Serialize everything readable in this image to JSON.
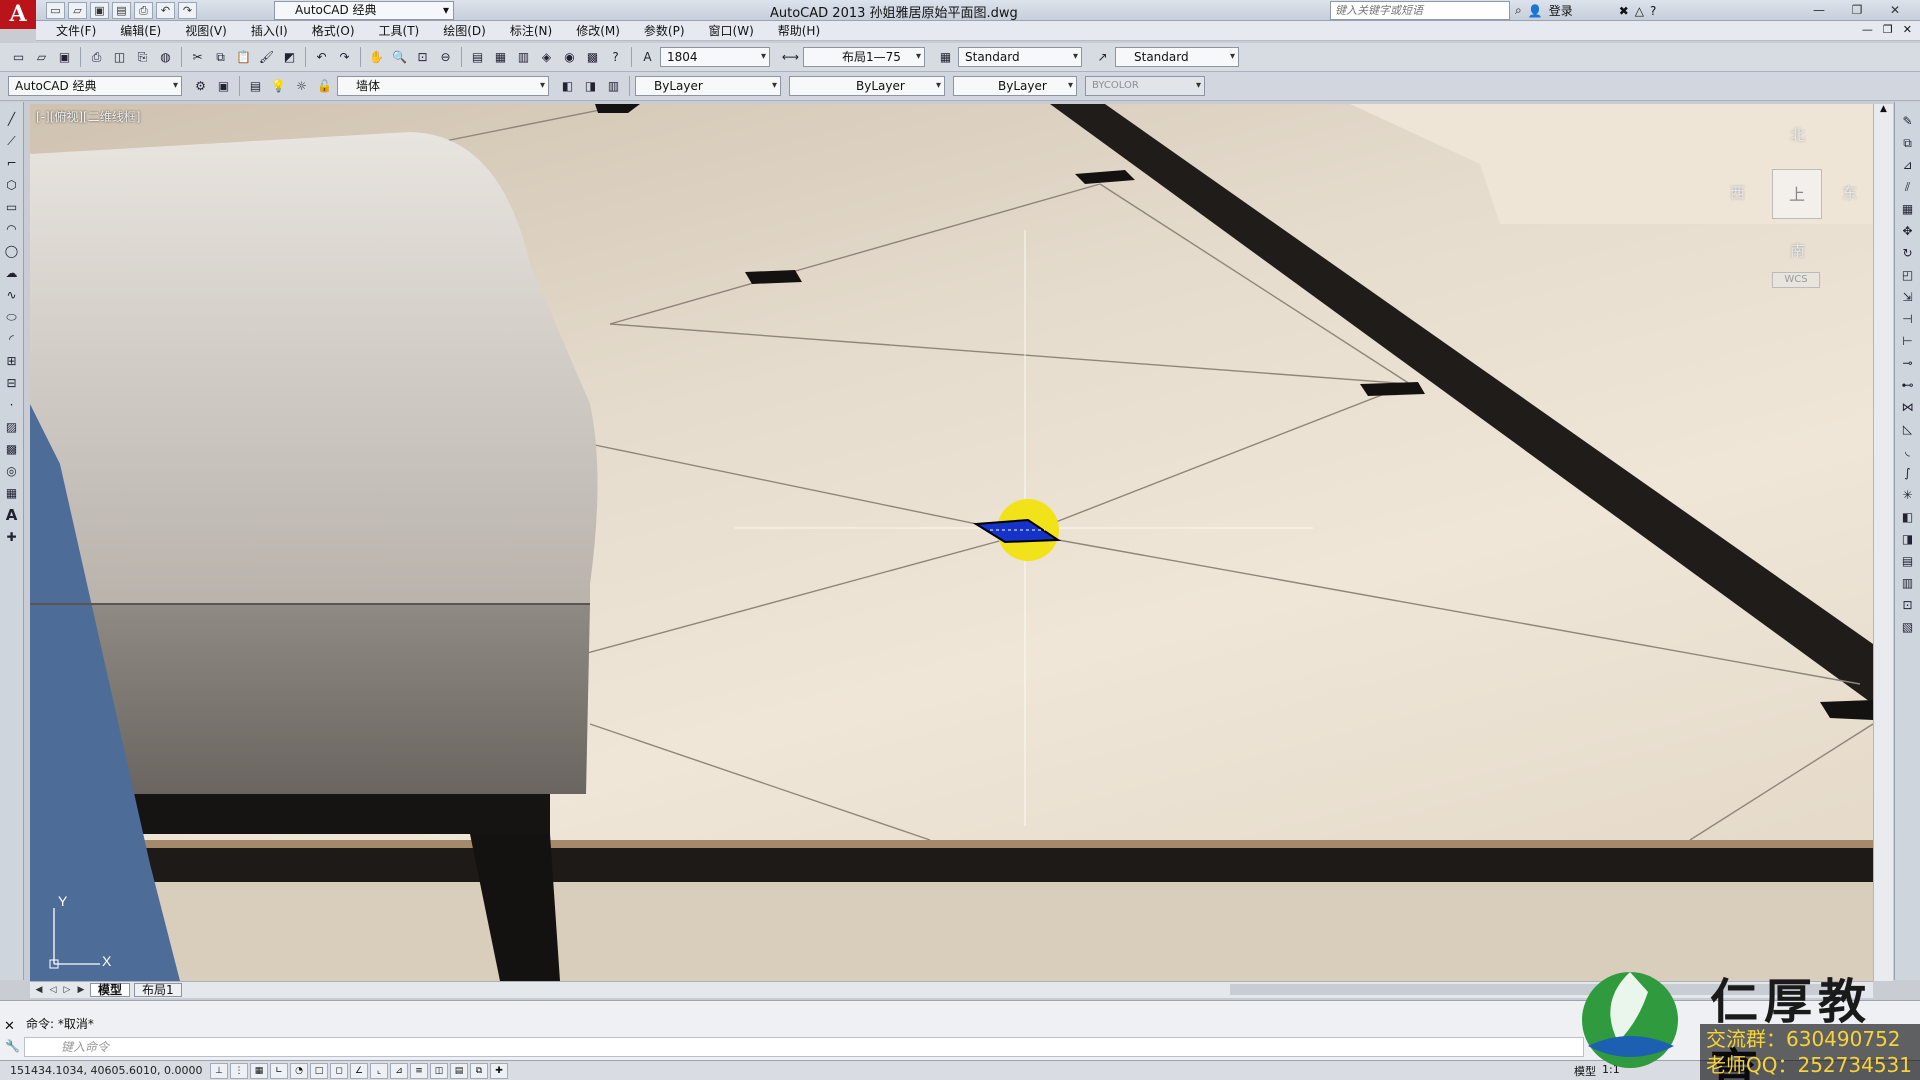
{
  "titlebar": {
    "app_logo": "A",
    "workspace": "AutoCAD 经典",
    "window_title": "AutoCAD 2013    孙姐雅居原始平面图.dwg",
    "search_placeholder": "键入关键字或短语",
    "login_label": "登录",
    "win_min": "—",
    "win_restore": "❐",
    "win_close": "✕"
  },
  "menu": [
    "文件(F)",
    "编辑(E)",
    "视图(V)",
    "插入(I)",
    "格式(O)",
    "工具(T)",
    "绘图(D)",
    "标注(N)",
    "修改(M)",
    "参数(P)",
    "窗口(W)",
    "帮助(H)"
  ],
  "toolbar1": {
    "scale_value": "1804",
    "dimstyle_value": "布局1—75",
    "textstyle_value": "Standard",
    "tablestyle_value": "Standard"
  },
  "toolbar2": {
    "workspace_value": "AutoCAD 经典",
    "layer_value": "墙体",
    "color_value": "ByLayer",
    "linetype_value": "ByLayer",
    "lineweight_value": "ByLayer",
    "plotstyle_value": "BYCOLOR"
  },
  "viewport": {
    "label": "[-][俯视][二维线框]",
    "compass": {
      "north": "北",
      "south": "南",
      "east": "东",
      "west": "西",
      "face": "上",
      "wcs": "WCS"
    },
    "ucs_x": "X",
    "ucs_y": "Y"
  },
  "tabs": [
    "模型",
    "布局1"
  ],
  "command": {
    "history": "命令: *取消*",
    "placeholder": "键入命令"
  },
  "status": {
    "coords": "151434.1034, 40605.6010, 0.0000",
    "model_label": "模型",
    "scale_label": "1:1"
  },
  "watermark": {
    "brand": "仁厚教育",
    "group_label": "交流群：630490752",
    "qq_label": "老师QQ：252734531"
  },
  "colors": {
    "accent": "#b8141a",
    "highlight": "#f2e21a",
    "selection": "#1532c9"
  }
}
